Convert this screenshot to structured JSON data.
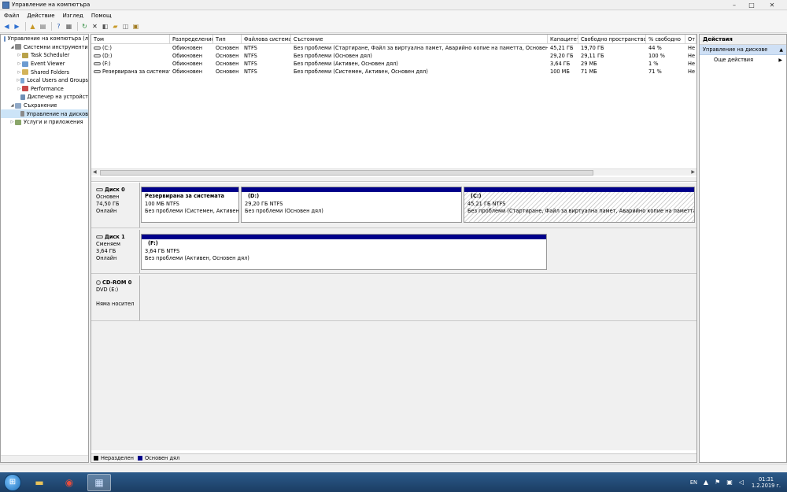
{
  "window": {
    "title": "Управление на компютъра"
  },
  "menu": [
    "Файл",
    "Действие",
    "Изглед",
    "Помощ"
  ],
  "tree": [
    {
      "label": "Управление на компютъра (л",
      "level": 0,
      "tri": "",
      "color": "#6a8fc2"
    },
    {
      "label": "Системни инструменти",
      "level": 1,
      "tri": "◢",
      "color": "#8b8b8b"
    },
    {
      "label": "Task Scheduler",
      "level": 2,
      "tri": "▷",
      "color": "#b9a24a"
    },
    {
      "label": "Event Viewer",
      "level": 2,
      "tri": "▷",
      "color": "#6c9bd1"
    },
    {
      "label": "Shared Folders",
      "level": 2,
      "tri": "▷",
      "color": "#d3b35a"
    },
    {
      "label": "Local Users and Groups",
      "level": 2,
      "tri": "▷",
      "color": "#7aa6d4"
    },
    {
      "label": "Performance",
      "level": 2,
      "tri": "▷",
      "color": "#c94a4a"
    },
    {
      "label": "Диспечер на устройст",
      "level": 2,
      "tri": "",
      "color": "#6f8fb5"
    },
    {
      "label": "Съхранение",
      "level": 1,
      "tri": "◢",
      "color": "#8fa8c6"
    },
    {
      "label": "Управление на дисков",
      "level": 2,
      "tri": "",
      "color": "#8a8a8a",
      "selected": true
    },
    {
      "label": "Услуги и приложения",
      "level": 1,
      "tri": "▷",
      "color": "#8aa66a"
    }
  ],
  "volumes": {
    "headers": [
      "Том",
      "Разпределение",
      "Тип",
      "Файлова система",
      "Състояние",
      "Капацитет",
      "Свободно пространство",
      "% свободно",
      "От"
    ],
    "rows": [
      [
        "(C:)",
        "Обикновен",
        "Основен",
        "NTFS",
        "Без проблеми (Стартиране, Файл за виртуална памет, Аварийно копие на паметта, Основен дял)",
        "45,21 ГБ",
        "19,70 ГБ",
        "44 %",
        "Не"
      ],
      [
        "(D:)",
        "Обикновен",
        "Основен",
        "NTFS",
        "Без проблеми (Основен дял)",
        "29,20 ГБ",
        "29,11 ГБ",
        "100 %",
        "Не"
      ],
      [
        "(F:)",
        "Обикновен",
        "Основен",
        "NTFS",
        "Без проблеми (Активен, Основен дял)",
        "3,64 ГБ",
        "29 МБ",
        "1 %",
        "Не"
      ],
      [
        "Резервирана за системата",
        "Обикновен",
        "Основен",
        "NTFS",
        "Без проблеми (Системен, Активен, Основен дял)",
        "100 МБ",
        "71 МБ",
        "71 %",
        "Не"
      ]
    ]
  },
  "disks": [
    {
      "name": "Диск 0",
      "type": "Основен",
      "size": "74,50 ГБ",
      "state": "Онлайн",
      "partitions": [
        {
          "name": "Резервирана за системата",
          "size": "100 МБ NTFS",
          "status": "Без проблеми (Системен, Активен,"
        },
        {
          "name": "(D:)",
          "size": "29,20 ГБ NTFS",
          "status": "Без проблеми (Основен дял)"
        },
        {
          "name": "(C:)",
          "size": "45,21 ГБ NTFS",
          "status": "Без проблеми (Стартиране, Файл за виртуална памет, Аварийно копие на паметта, Осн"
        }
      ]
    },
    {
      "name": "Диск 1",
      "type": "Сменяем",
      "size": "3,64 ГБ",
      "state": "Онлайн",
      "partitions": [
        {
          "name": "(F:)",
          "size": "3,64 ГБ NTFS",
          "status": "Без проблеми (Активен, Основен дял)"
        }
      ]
    },
    {
      "name": "CD-ROM 0",
      "type": "DVD (E:)",
      "size": "",
      "state": "Няма носител",
      "partitions": []
    }
  ],
  "legend": [
    {
      "label": "Неразделен",
      "color": "#000000"
    },
    {
      "label": "Основен дял",
      "color": "#00008b"
    }
  ],
  "actions": {
    "title": "Действия",
    "section": "Управление на дискове",
    "items": [
      "Още действия"
    ]
  },
  "taskbar": {
    "lang": "EN",
    "time": "01:31",
    "date": "1.2.2019 г."
  }
}
